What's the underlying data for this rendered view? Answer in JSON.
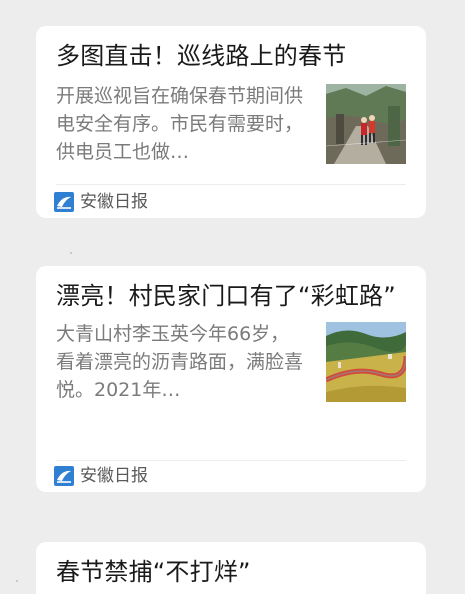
{
  "articles": [
    {
      "title": "多图直击！巡线路上的春节",
      "summary": "开展巡视旨在确保春节期间供电安全有序。市民有需要时，供电员工也做…",
      "source": "安徽日报",
      "thumbnail": "photo-linemen-walking-mountain-path"
    },
    {
      "title": "漂亮！村民家门口有了“彩虹路”",
      "summary": "大青山村李玉英今年66岁，看着漂亮的沥青路面，满脸喜悦。2021年…",
      "source": "安徽日报",
      "thumbnail": "photo-red-road-through-hills"
    },
    {
      "title": "春节禁捕“不打烊”"
    }
  ],
  "colors": {
    "background": "#ededed",
    "card": "#ffffff",
    "title": "#1a1a1a",
    "summary": "#7b7b7b",
    "logo_blue": "#2f7fd3"
  }
}
